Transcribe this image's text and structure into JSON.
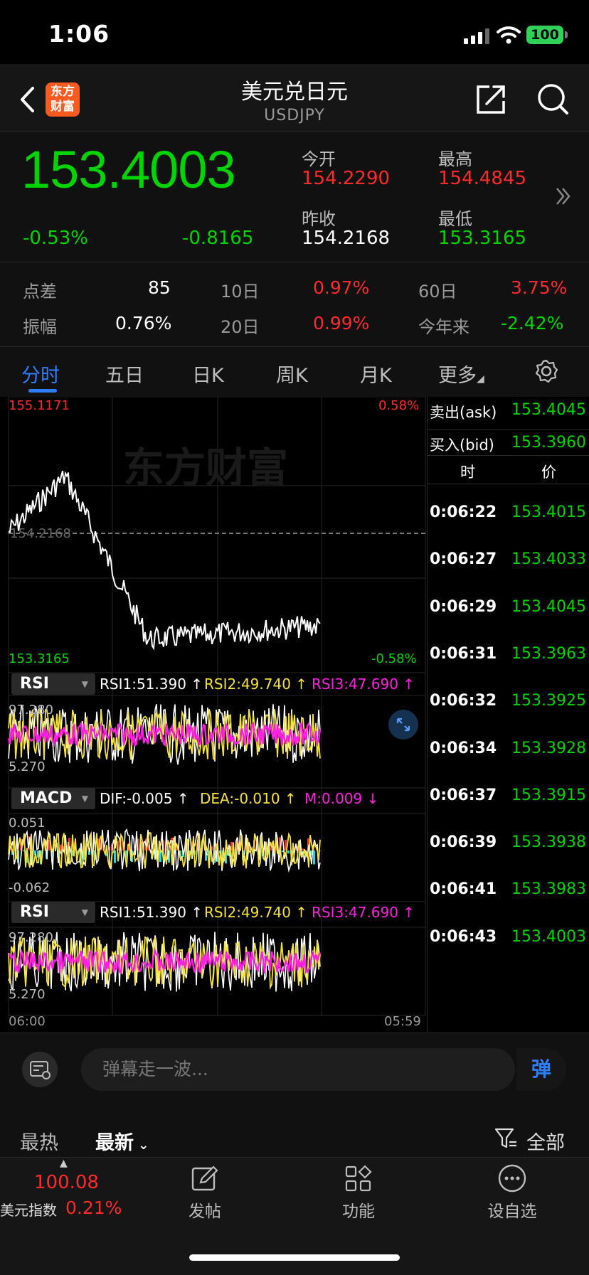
{
  "status": {
    "time": "1:06",
    "battery": "100"
  },
  "header": {
    "logo_text": "东方\n财富",
    "title": "美元兑日元",
    "subtitle": "USDJPY"
  },
  "quote": {
    "price": "153.4003",
    "change_pct": "-0.53%",
    "change": "-0.8165",
    "open_label": "今开",
    "open": "154.2290",
    "high_label": "最高",
    "high": "154.4845",
    "prev_close_label": "昨收",
    "prev_close": "154.2168",
    "low_label": "最低",
    "low": "153.3165"
  },
  "stats": {
    "spread_label": "点差",
    "spread": "85",
    "d10_label": "10日",
    "d10": "0.97%",
    "d60_label": "60日",
    "d60": "3.75%",
    "amplitude_label": "振幅",
    "amplitude": "0.76%",
    "d20_label": "20日",
    "d20": "0.99%",
    "ytd_label": "今年来",
    "ytd": "-2.42%"
  },
  "tabs": [
    "分时",
    "五日",
    "日K",
    "周K",
    "月K",
    "更多"
  ],
  "chart": {
    "price_max": "155.1171",
    "price_min": "153.3165",
    "pct_max": "0.58%",
    "pct_min": "-0.58%",
    "prev_close_marker": "154.2168",
    "watermark": "东方财富",
    "time_start": "06:00",
    "time_end": "05:59",
    "rsi": {
      "name": "RSI",
      "rsi1": "RSI1:51.390 ↑",
      "rsi2": "RSI2:49.740 ↑",
      "rsi3": "RSI3:47.690 ↑",
      "max": "97.280",
      "min": "5.270"
    },
    "macd": {
      "name": "MACD",
      "dif": "DIF:-0.005 ↑",
      "dea": "DEA:-0.010 ↑",
      "m": "M:0.009 ↓",
      "max": "0.051",
      "min": "-0.062"
    },
    "rsi_b": {
      "name": "RSI",
      "rsi1": "RSI1:51.390 ↑",
      "rsi2": "RSI2:49.740 ↑",
      "rsi3": "RSI3:47.690 ↑",
      "max": "97.280",
      "min": "5.270"
    }
  },
  "side": {
    "ask_label": "卖出(ask)",
    "ask": "153.4045",
    "bid_label": "买入(bid)",
    "bid": "153.3960",
    "col_time": "时",
    "col_price": "价",
    "ticks": [
      {
        "time": "0:06:22",
        "price": "153.4015"
      },
      {
        "time": "0:06:27",
        "price": "153.4033"
      },
      {
        "time": "0:06:29",
        "price": "153.4045"
      },
      {
        "time": "0:06:31",
        "price": "153.3963"
      },
      {
        "time": "0:06:32",
        "price": "153.3925"
      },
      {
        "time": "0:06:34",
        "price": "153.3928"
      },
      {
        "time": "0:06:37",
        "price": "153.3915"
      },
      {
        "time": "0:06:39",
        "price": "153.3938"
      },
      {
        "time": "0:06:41",
        "price": "153.3983"
      },
      {
        "time": "0:06:43",
        "price": "153.4003"
      }
    ]
  },
  "comment": {
    "placeholder": "弹幕走一波...",
    "send": "弹"
  },
  "feed": {
    "hot": "最热",
    "latest": "最新",
    "filter": "全部"
  },
  "tabbar": {
    "index_value": "100.08",
    "index_name": "美元指数",
    "index_change": "0.21%",
    "post": "发帖",
    "func": "功能",
    "watch": "设自选"
  },
  "colors": {
    "up": "#ff2a2a",
    "down": "#00d400",
    "accent": "#2e7fff",
    "rsi1": "#ffffff",
    "rsi2": "#f5e23a",
    "rsi3": "#ff1fe0"
  }
}
